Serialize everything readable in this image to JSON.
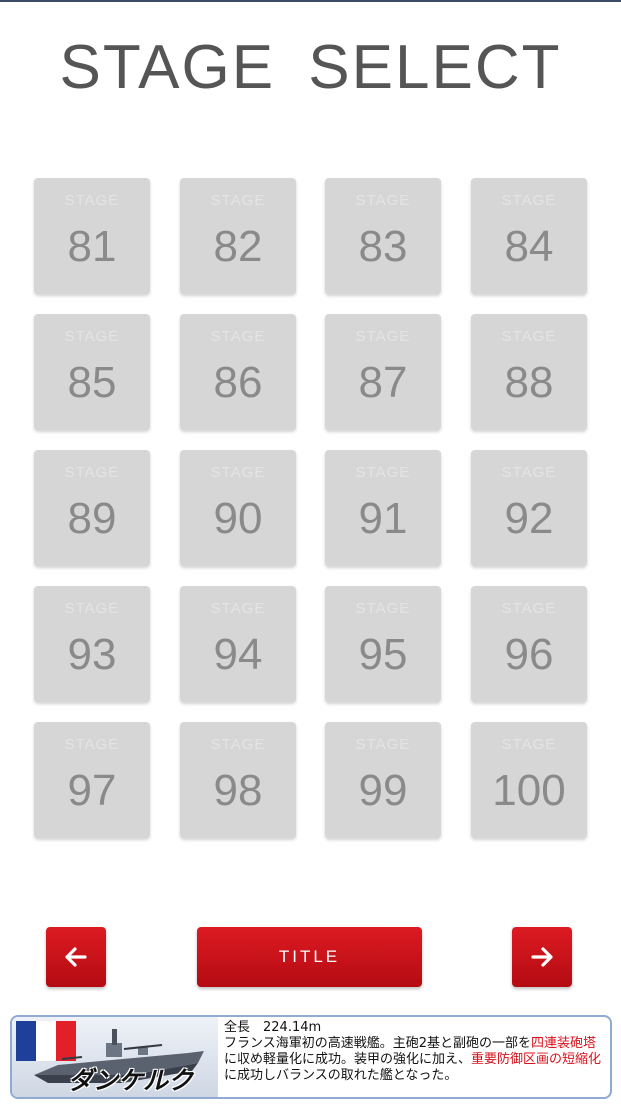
{
  "header": {
    "title": "STAGE  SELECT"
  },
  "stages": [
    {
      "caption": "STAGE",
      "number": "81"
    },
    {
      "caption": "STAGE",
      "number": "82"
    },
    {
      "caption": "STAGE",
      "number": "83"
    },
    {
      "caption": "STAGE",
      "number": "84"
    },
    {
      "caption": "STAGE",
      "number": "85"
    },
    {
      "caption": "STAGE",
      "number": "86"
    },
    {
      "caption": "STAGE",
      "number": "87"
    },
    {
      "caption": "STAGE",
      "number": "88"
    },
    {
      "caption": "STAGE",
      "number": "89"
    },
    {
      "caption": "STAGE",
      "number": "90"
    },
    {
      "caption": "STAGE",
      "number": "91"
    },
    {
      "caption": "STAGE",
      "number": "92"
    },
    {
      "caption": "STAGE",
      "number": "93"
    },
    {
      "caption": "STAGE",
      "number": "94"
    },
    {
      "caption": "STAGE",
      "number": "95"
    },
    {
      "caption": "STAGE",
      "number": "96"
    },
    {
      "caption": "STAGE",
      "number": "97"
    },
    {
      "caption": "STAGE",
      "number": "98"
    },
    {
      "caption": "STAGE",
      "number": "99"
    },
    {
      "caption": "STAGE",
      "number": "100"
    }
  ],
  "nav": {
    "prev_icon": "arrow-left-icon",
    "next_icon": "arrow-right-icon",
    "title_label": "TITLE",
    "accent_color": "#c8111a"
  },
  "banner": {
    "ship_name": "ダンケルク",
    "flag": "france-flag",
    "length_line": "全長　224.14m",
    "desc_1": "フランス海軍初の高速戦艦。主砲2基と副砲の一部を",
    "desc_hl_1": "四連装砲塔",
    "desc_2": "に収め軽量化に成功。装甲の強化に加え、",
    "desc_hl_2": "重要防御区画の短縮化",
    "desc_3": "に成功しバランスの取れた艦となった。",
    "highlight_color": "#d8111b"
  }
}
